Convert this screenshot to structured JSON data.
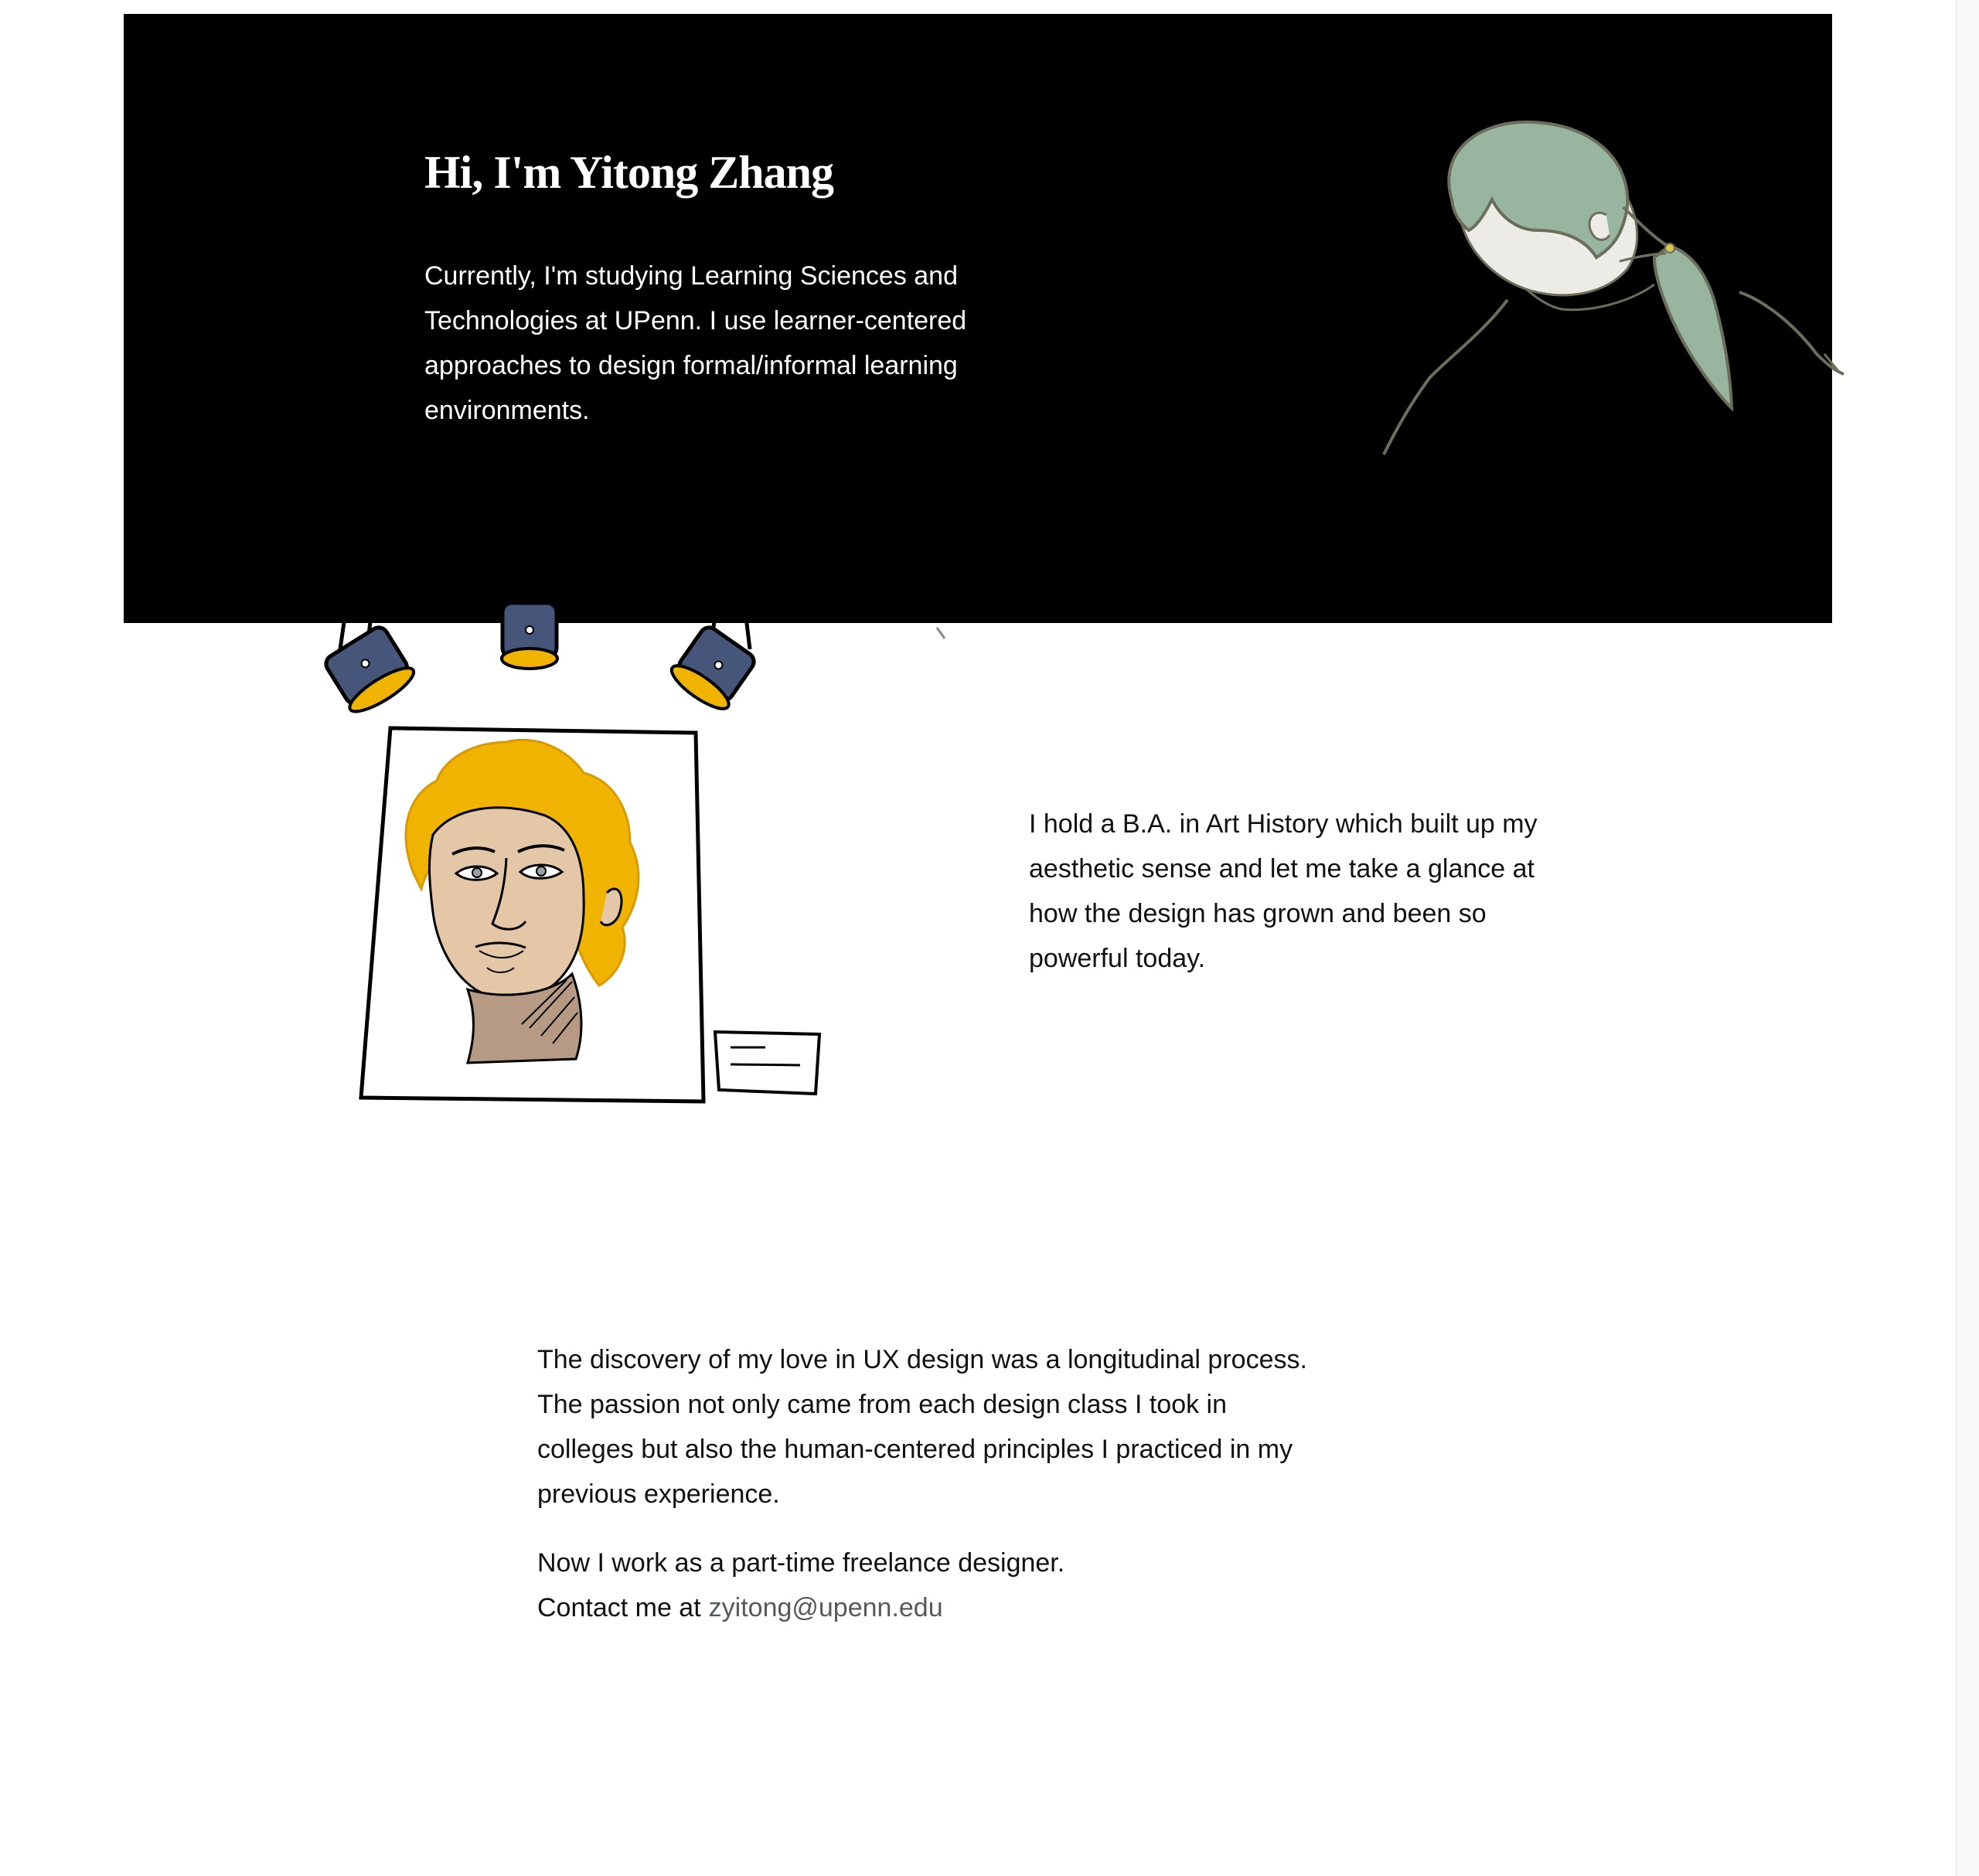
{
  "hero": {
    "title": "Hi, I'm Yitong Zhang",
    "intro": "Currently, I'm studying Learning Sciences and Technologies at UPenn. I use learner-centered approaches to design formal/informal learning environments."
  },
  "art_history": {
    "text": "I hold a B.A. in Art History which built up my aesthetic sense and let me take a glance at how the design has grown and been so powerful today."
  },
  "ux_story": {
    "text": "The discovery of my love in UX design was a longitudinal process. The passion not only came from each design class I took in colleges but also the human-centered principles I practiced in my previous experience."
  },
  "contact": {
    "work_line": "Now I work as a part-time freelance designer.",
    "prefix": "Contact me at",
    "email": "zyitong@upenn.edu"
  },
  "colors": {
    "hero_background": "#000000",
    "hair_green": "#97b59f",
    "painting_gold": "#f0b400",
    "lamp_blue": "#46557a",
    "link_gray": "#555a5e"
  }
}
